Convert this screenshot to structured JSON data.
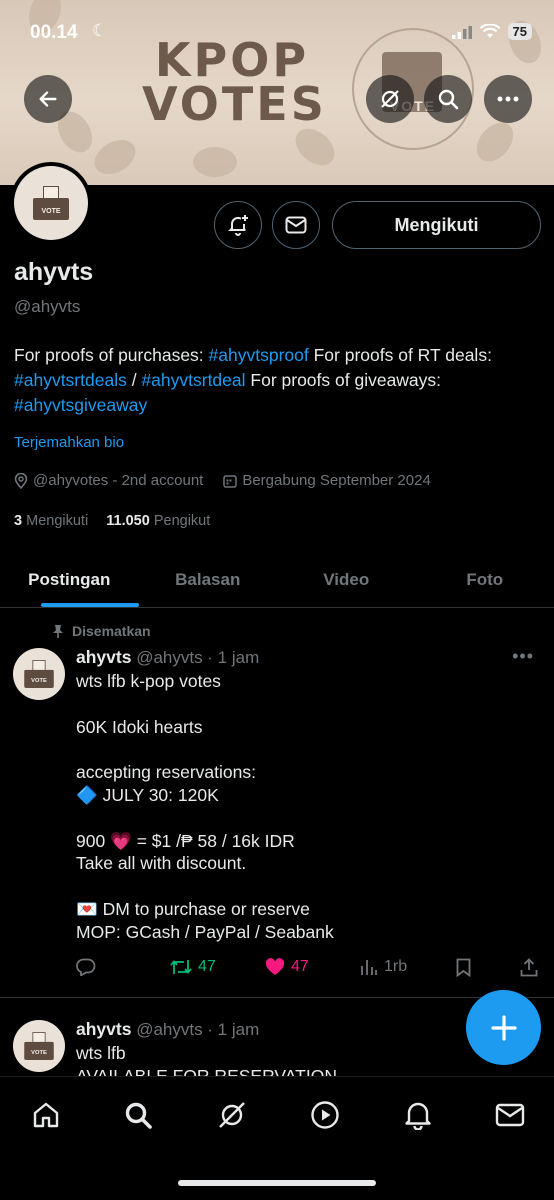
{
  "status_bar": {
    "time": "00.14",
    "battery": "75"
  },
  "banner": {
    "title_line1": "KPOP",
    "title_line2": "VOTES",
    "seal_label": "VOTE"
  },
  "avatar": {
    "label": "VOTE"
  },
  "profile": {
    "follow_button": "Mengikuti",
    "name": "ahyvts",
    "handle": "@ahyvts",
    "bio": {
      "t1": "For proofs of purchases: ",
      "l1": "#ahyvtsproof",
      "t2": " For proofs of RT deals: ",
      "l2": "#ahyvtsrtdeals",
      "t3": " / ",
      "l3": "#ahyvtsrtdeal",
      "t4": " For proofs of giveaways: ",
      "l4": "#ahyvtsgiveaway"
    },
    "translate_bio": "Terjemahkan bio",
    "location": "@ahyvotes - 2nd account",
    "joined": "Bergabung September 2024",
    "following_count": "3",
    "following_label": "Mengikuti",
    "followers_count": "11.050",
    "followers_label": "Pengikut"
  },
  "tabs": [
    {
      "label": "Postingan",
      "active": true
    },
    {
      "label": "Balasan"
    },
    {
      "label": "Video"
    },
    {
      "label": "Foto"
    }
  ],
  "posts": [
    {
      "pinned_label": "Disematkan",
      "name": "ahyvts",
      "handle_time": "@ahyvts · 1 jam",
      "body": "wts lfb k-pop votes\n\n60K Idoki hearts\n\naccepting reservations:\n🔷 JULY 30: 120K\n\n900 💗 = $1 /₱ 58 / 16k IDR\nTake all with discount.\n\n💌 DM to purchase or reserve\nMOP: GCash / PayPal / Seabank",
      "retweets": "47",
      "likes": "47",
      "views": "1rb"
    },
    {
      "name": "ahyvts",
      "handle_time": "@ahyvts · 1 jam",
      "body": "wts lfb\nAVAILABLE FOR RESERVATION"
    }
  ],
  "colors": {
    "accent": "#1d9bf0",
    "like": "#f91880",
    "retweet": "#00ba7c",
    "muted": "#71767b"
  }
}
